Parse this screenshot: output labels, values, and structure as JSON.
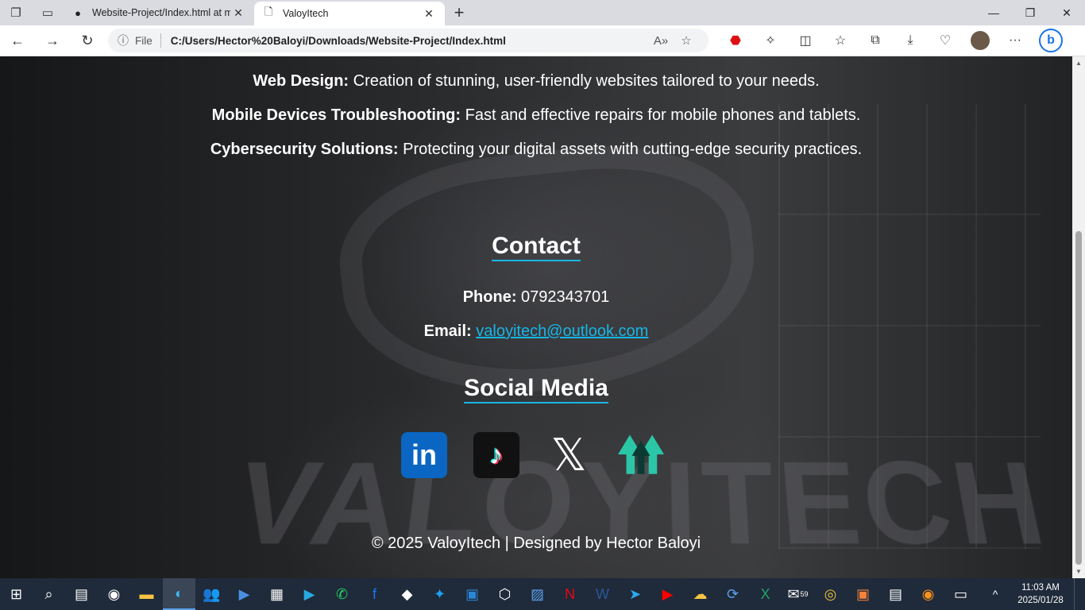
{
  "browser": {
    "tabs": [
      {
        "label": "Website-Project/Index.html at m",
        "favicon": "github-icon",
        "active": false
      },
      {
        "label": "ValoyItech",
        "favicon": "page-icon",
        "active": true
      }
    ],
    "address": {
      "scheme_label": "File",
      "url": "C:/Users/Hector%20Baloyi/Downloads/Website-Project/Index.html"
    }
  },
  "page": {
    "services": [
      {
        "title": "Web Design:",
        "desc": "Creation of stunning, user-friendly websites tailored to your needs."
      },
      {
        "title": "Mobile Devices Troubleshooting:",
        "desc": "Fast and effective repairs for mobile phones and tablets."
      },
      {
        "title": "Cybersecurity Solutions:",
        "desc": "Protecting your digital assets with cutting-edge security practices."
      }
    ],
    "contact": {
      "heading": "Contact",
      "phone_label": "Phone:",
      "phone": "0792343701",
      "email_label": "Email:",
      "email": "valoyitech@outlook.com"
    },
    "social": {
      "heading": "Social Media",
      "links": [
        "linkedin-icon",
        "tiktok-icon",
        "x-icon",
        "linktree-icon"
      ]
    },
    "footer": "© 2025 ValoyItech | Designed by Hector Baloyi"
  },
  "taskbar": {
    "time": "11:03 AM",
    "date": "2025/01/28",
    "badge": "59"
  },
  "colors": {
    "accent": "#17b6e6",
    "taskbar": "#1f2a3a"
  }
}
